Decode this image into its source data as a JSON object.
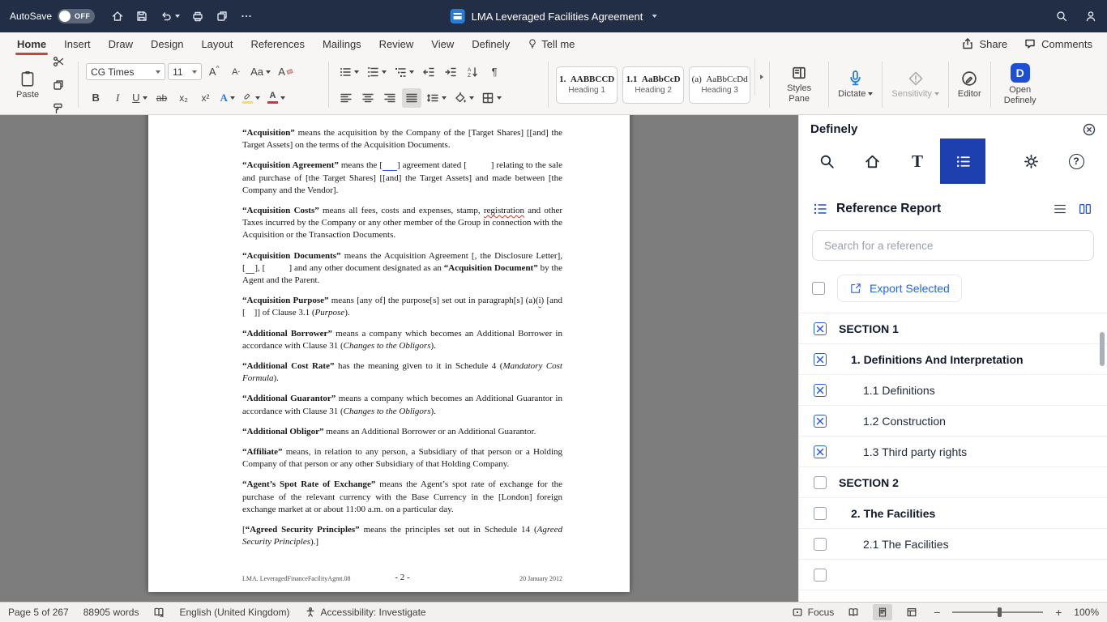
{
  "colors": {
    "titlebar_bg": "#222e45",
    "accent_red": "#c74634",
    "word_blue": "#2b7cd3",
    "definely_active": "#1e3fae",
    "link_blue": "#2563eb",
    "check_blue": "#2b5cd9",
    "doc_canvas": "#7d7d7d"
  },
  "icons": {
    "search-icon": "magnifier",
    "home-icon": "house",
    "save-icon": "floppy",
    "undo-icon": "arrow-undo",
    "print-icon": "printer",
    "copy-icon": "sheets",
    "more-icon": "ellipsis",
    "account-icon": "person",
    "lightbulb-icon": "bulb",
    "mic-icon": "microphone",
    "gear-icon": "gear",
    "help-icon": "question-circle",
    "close-icon": "circle-x",
    "list-icon": "dotted-list",
    "external-link-icon": "box-arrow",
    "columns-icon": "two-columns"
  },
  "titlebar": {
    "autosave_label": "AutoSave",
    "autosave_state": "OFF",
    "title": "LMA Leveraged Facilities Agreement"
  },
  "ribbon": {
    "tabs": [
      {
        "label": "Home",
        "active": true
      },
      {
        "label": "Insert"
      },
      {
        "label": "Draw"
      },
      {
        "label": "Design"
      },
      {
        "label": "Layout"
      },
      {
        "label": "References"
      },
      {
        "label": "Mailings"
      },
      {
        "label": "Review"
      },
      {
        "label": "View"
      },
      {
        "label": "Definely"
      },
      {
        "label": "Tell me",
        "icon": "lightbulb"
      }
    ],
    "share_label": "Share",
    "comments_label": "Comments",
    "paste_label": "Paste",
    "font_name": "CG Times",
    "font_size": "11",
    "styles": [
      {
        "sample": "1.  AABBCCD",
        "name": "Heading 1",
        "bold": true
      },
      {
        "sample": "1.1  AaBbCcD",
        "name": "Heading 2",
        "bold": true
      },
      {
        "sample": "(a)  AaBbCcDd",
        "name": "Heading 3",
        "bold": false
      }
    ],
    "styles_pane_label": "Styles Pane",
    "dictate_label": "Dictate",
    "sensitivity_label": "Sensitivity",
    "editor_label": "Editor",
    "open_definely_label": "Open Definely"
  },
  "document": {
    "paragraphs": [
      [
        {
          "t": "“Acquisition”",
          "b": true
        },
        {
          "t": " means the acquisition by the Company of the [Target Shares] [[and] the Target Assets] on the terms of the Acquisition Documents."
        }
      ],
      [
        {
          "t": "“Acquisition Agreement”",
          "b": true
        },
        {
          "t": " means the ["
        },
        {
          "t": "      ",
          "u": "blue"
        },
        {
          "t": "] agreement dated [          ] relating to the sale and purchase of [the Target Shares] [[and] the Target Assets] and made between [the Company and the Vendor]."
        }
      ],
      [
        {
          "t": "“Acquisition Costs”",
          "b": true
        },
        {
          "t": " means all fees, costs and expenses, stamp, "
        },
        {
          "t": "registration",
          "u": "red"
        },
        {
          "t": " and other Taxes incurred by the Company or any other member of the Group in connection with the Acquisition or the Transaction Documents."
        }
      ],
      [
        {
          "t": "“Acquisition Documents”",
          "b": true
        },
        {
          "t": " means the Acquisition Agreement [, the Disclosure Letter], ["
        },
        {
          "t": "    ",
          "u": "blue"
        },
        {
          "t": "], [          ] and any other document designated as an "
        },
        {
          "t": "“Acquisition Document”",
          "b": true
        },
        {
          "t": " by the Agent and the Parent."
        }
      ],
      [
        {
          "t": "“Acquisition Purpose”",
          "b": true
        },
        {
          "t": " means [any of] the purpose[s] set out in paragraph[s] (a)("
        },
        {
          "t": "i",
          "u": "red"
        },
        {
          "t": ") [and [    ]] of Clause 3.1 ("
        },
        {
          "t": "Purpose",
          "i": true
        },
        {
          "t": ")."
        }
      ],
      [
        {
          "t": "“Additional Borrower”",
          "b": true
        },
        {
          "t": " means a company which becomes an Additional Borrower in accordance with Clause 31 ("
        },
        {
          "t": "Changes to the Obligors",
          "i": true
        },
        {
          "t": ")."
        }
      ],
      [
        {
          "t": "“Additional Cost Rate”",
          "b": true
        },
        {
          "t": " has the meaning given to it in Schedule 4 ("
        },
        {
          "t": "Mandatory Cost Formula",
          "i": true
        },
        {
          "t": ")."
        }
      ],
      [
        {
          "t": "“Additional Guarantor”",
          "b": true
        },
        {
          "t": " means a company which becomes an Additional Guarantor in accordance with Clause 31 ("
        },
        {
          "t": "Changes to the Obligors",
          "i": true
        },
        {
          "t": ")."
        }
      ],
      [
        {
          "t": "“Additional Obligor”",
          "b": true
        },
        {
          "t": " means an Additional Borrower or an Additional Guarantor."
        }
      ],
      [
        {
          "t": "“Affiliate”",
          "b": true
        },
        {
          "t": " means, in relation to any person, a Subsidiary of that person or a Holding Company of that person or any other Subsidiary of that Holding Company."
        }
      ],
      [
        {
          "t": "“Agent’s Spot Rate of Exchange”",
          "b": true
        },
        {
          "t": " means the Agent’s spot rate of exchange for the purchase of the relevant currency with the Base Currency in the [London] foreign exchange market at or about 11:00 a.m. on a particular day."
        }
      ],
      [
        {
          "t": "["
        },
        {
          "t": "“Agreed Security Principles”",
          "b": true
        },
        {
          "t": " means the principles set out in Schedule 14 ("
        },
        {
          "t": "Agreed Security Principles",
          "i": true
        },
        {
          "t": ").]"
        }
      ]
    ],
    "footer": {
      "left": "LMA. LeveragedFinanceFacilityAgmt.08",
      "center": "- 2 -",
      "right": "20 January 2012"
    }
  },
  "panel": {
    "title": "Definely",
    "report_title": "Reference Report",
    "search_placeholder": "Search for a reference",
    "export_label": "Export Selected",
    "rows": [
      {
        "label": "SECTION 1",
        "level": 0,
        "checked": true,
        "bold": true
      },
      {
        "label": "1. Definitions And Interpretation",
        "level": 1,
        "checked": true,
        "bold": true
      },
      {
        "label": "1.1 Definitions",
        "level": 2,
        "checked": true,
        "bold": false
      },
      {
        "label": "1.2 Construction",
        "level": 2,
        "checked": true,
        "bold": false
      },
      {
        "label": "1.3 Third party rights",
        "level": 2,
        "checked": true,
        "bold": false
      },
      {
        "label": "SECTION 2",
        "level": 0,
        "checked": false,
        "bold": true
      },
      {
        "label": "2. The Facilities",
        "level": 1,
        "checked": false,
        "bold": true
      },
      {
        "label": "2.1 The Facilities",
        "level": 2,
        "checked": false,
        "bold": false
      },
      {
        "label": "",
        "level": 2,
        "checked": false,
        "bold": false
      }
    ]
  },
  "statusbar": {
    "page": "Page 5 of 267",
    "words": "88905 words",
    "language": "English (United Kingdom)",
    "accessibility": "Accessibility: Investigate",
    "focus_label": "Focus",
    "zoom": "100%"
  }
}
